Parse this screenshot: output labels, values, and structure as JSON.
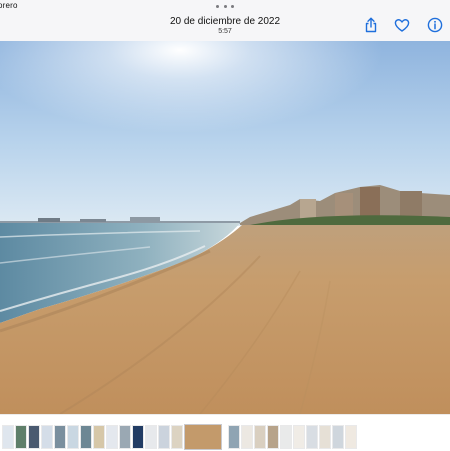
{
  "top_bar": {
    "back_label": "orero",
    "date": "20 de diciembre de 2022",
    "time": "5:57",
    "share_icon": "share-icon",
    "favorite_icon": "heart-icon",
    "info_icon": "info-icon",
    "accent": "#1f6fdc"
  },
  "photo": {
    "subject": "beach-photo",
    "sky_color": "#b8d3ec",
    "sand_color": "#c39a6b",
    "sea_color": "#6e95a8"
  },
  "filmstrip": {
    "thumbnails": [
      {
        "kind": "document",
        "color": "#dfe6ee"
      },
      {
        "kind": "photo",
        "color": "#5f7f6a"
      },
      {
        "kind": "photo",
        "color": "#4a5a70"
      },
      {
        "kind": "document",
        "color": "#d4dde8"
      },
      {
        "kind": "photo",
        "color": "#7a8f9e"
      },
      {
        "kind": "document",
        "color": "#c9d7e2"
      },
      {
        "kind": "photo",
        "color": "#6d8794"
      },
      {
        "kind": "photo",
        "color": "#d6c7a8"
      },
      {
        "kind": "document",
        "color": "#e4e8ee"
      },
      {
        "kind": "photo",
        "color": "#9aa8b3"
      },
      {
        "kind": "document",
        "color": "#223c64"
      },
      {
        "kind": "photo",
        "color": "#e7e9ec"
      },
      {
        "kind": "document",
        "color": "#cbd3dd"
      },
      {
        "kind": "photo",
        "color": "#dcd3c2"
      },
      {
        "kind": "current",
        "color": "#c39a6b"
      },
      {
        "kind": "photo",
        "color": "#8fa4b3"
      },
      {
        "kind": "photo",
        "color": "#ece8e2"
      },
      {
        "kind": "photo",
        "color": "#d9cfc0"
      },
      {
        "kind": "photo",
        "color": "#b7a38a"
      },
      {
        "kind": "photo",
        "color": "#e9eaea"
      },
      {
        "kind": "photo",
        "color": "#f0ece6"
      },
      {
        "kind": "photo",
        "color": "#d8dde3"
      },
      {
        "kind": "photo",
        "color": "#e6e0d6"
      },
      {
        "kind": "photo",
        "color": "#cfd6dd"
      },
      {
        "kind": "photo",
        "color": "#efe9e1"
      }
    ]
  }
}
